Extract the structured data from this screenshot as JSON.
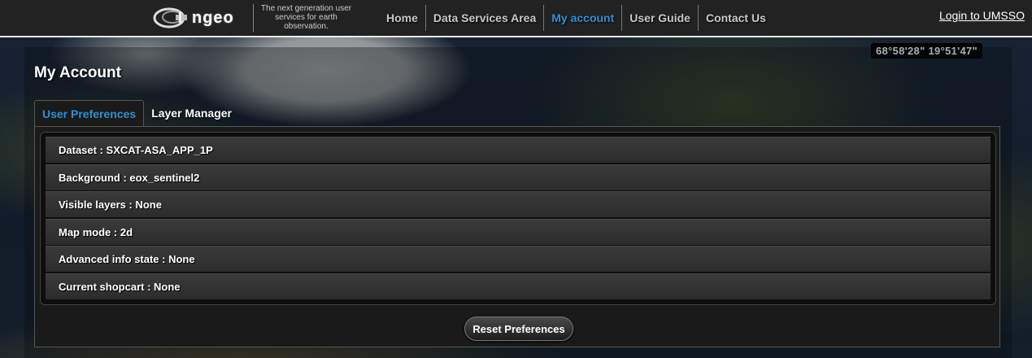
{
  "header": {
    "logo_text": "ngeo",
    "tagline": "The next generation user services for earth observation.",
    "nav": [
      {
        "label": "Home",
        "active": false
      },
      {
        "label": "Data Services Area",
        "active": false
      },
      {
        "label": "My account",
        "active": true
      },
      {
        "label": "User Guide",
        "active": false
      },
      {
        "label": "Contact Us",
        "active": false
      }
    ],
    "login_label": "Login to UMSSO"
  },
  "map": {
    "coordinates": "68°58'28\" 19°51'47\""
  },
  "account": {
    "title": "My Account",
    "tabs": [
      {
        "label": "User Preferences",
        "active": true
      },
      {
        "label": "Layer Manager",
        "active": false
      }
    ],
    "preferences": [
      "Dataset : SXCAT-ASA_APP_1P",
      "Background : eox_sentinel2",
      "Visible layers : None",
      "Map mode : 2d",
      "Advanced info state : None",
      "Current shopcart : None"
    ],
    "reset_label": "Reset Preferences"
  },
  "colors": {
    "accent": "#2f8fd8",
    "header_bg": "#222222"
  }
}
